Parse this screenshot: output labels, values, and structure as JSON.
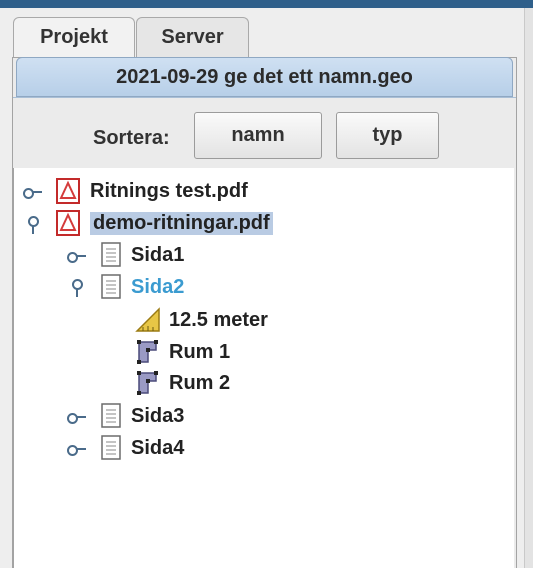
{
  "tabs": [
    {
      "label": "Projekt"
    },
    {
      "label": "Server"
    }
  ],
  "file_tab": {
    "title": "2021-09-29 ge det ett namn.geo"
  },
  "sort": {
    "label": "Sortera:",
    "buttons": [
      {
        "label": "namn"
      },
      {
        "label": "typ"
      }
    ]
  },
  "tree": {
    "items": [
      {
        "label": "Ritnings test.pdf",
        "icon": "pdf-icon",
        "state": "collapsed"
      },
      {
        "label": "demo-ritningar.pdf",
        "icon": "pdf-icon",
        "state": "expanded",
        "selected": true
      },
      {
        "label": "Sida1",
        "icon": "page-icon",
        "state": "collapsed"
      },
      {
        "label": "Sida2",
        "icon": "page-icon",
        "state": "expanded",
        "highlight_color": "#3b9bd0"
      },
      {
        "label": "12.5 meter",
        "icon": "measure-icon"
      },
      {
        "label": "Rum 1",
        "icon": "room-icon"
      },
      {
        "label": "Rum 2",
        "icon": "room-icon"
      },
      {
        "label": "Sida3",
        "icon": "page-icon",
        "state": "collapsed"
      },
      {
        "label": "Sida4",
        "icon": "page-icon",
        "state": "collapsed"
      }
    ]
  },
  "colors": {
    "topbar": "#2f5f8a",
    "selection": "#b9cbe3",
    "file_tab": "#c3d7ee"
  }
}
